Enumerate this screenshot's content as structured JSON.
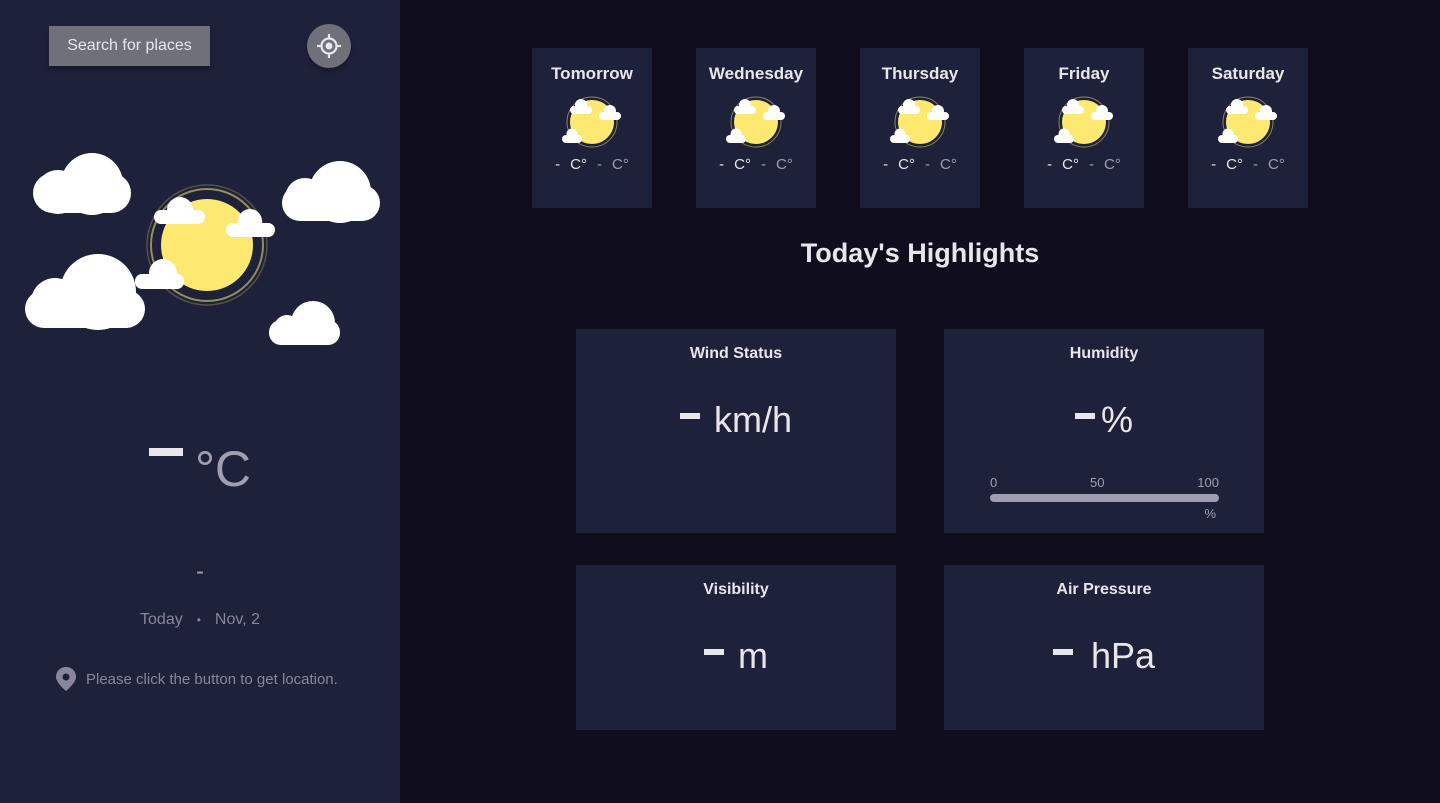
{
  "sidebar": {
    "search_label": "Search for places",
    "locate_icon": "crosshair-icon",
    "weather_icon": "partly-cloudy-icon",
    "temp_unit": "°C",
    "condition": "-",
    "date_today": "Today",
    "date_sep": "•",
    "date_value": "Nov, 2",
    "location_text": "Please click the button to get location."
  },
  "forecast": [
    {
      "day": "Tomorrow",
      "max": "C°",
      "min": "C°",
      "icon": "partly-cloudy-icon",
      "max_dash": "-",
      "min_dash": "-"
    },
    {
      "day": "Wednesday",
      "max": "C°",
      "min": "C°",
      "icon": "partly-cloudy-icon",
      "max_dash": "-",
      "min_dash": "-"
    },
    {
      "day": "Thursday",
      "max": "C°",
      "min": "C°",
      "icon": "partly-cloudy-icon",
      "max_dash": "-",
      "min_dash": "-"
    },
    {
      "day": "Friday",
      "max": "C°",
      "min": "C°",
      "icon": "partly-cloudy-icon",
      "max_dash": "-",
      "min_dash": "-"
    },
    {
      "day": "Saturday",
      "max": "C°",
      "min": "C°",
      "icon": "partly-cloudy-icon",
      "max_dash": "-",
      "min_dash": "-"
    }
  ],
  "highlights": {
    "title": "Today's Highlights",
    "wind": {
      "label": "Wind Status",
      "unit": "km/h"
    },
    "humidity": {
      "label": "Humidity",
      "unit": "%",
      "tick_0": "0",
      "tick_50": "50",
      "tick_100": "100",
      "bar_unit": "%"
    },
    "visibility": {
      "label": "Visibility",
      "unit": "m"
    },
    "pressure": {
      "label": "Air Pressure",
      "unit": "hPa"
    }
  },
  "colors": {
    "sidebar_bg": "#1e213a",
    "main_bg": "#100e1d",
    "card_bg": "#1e213a",
    "sun": "#fde872",
    "text": "#e7e7eb",
    "muted": "#a09fb1"
  }
}
